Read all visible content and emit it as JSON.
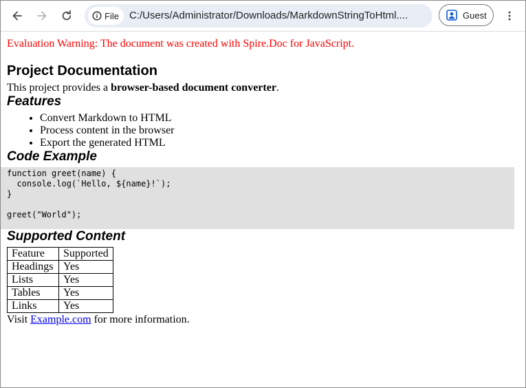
{
  "browser": {
    "nav": {
      "back_icon": "arrow-left-icon",
      "forward_icon": "arrow-right-icon",
      "reload_icon": "reload-icon"
    },
    "address_bar": {
      "chip_label": "File",
      "chip_icon": "info-circle-icon",
      "url": "C:/Users/Administrator/Downloads/MarkdownStringToHtml...."
    },
    "profile": {
      "label": "Guest",
      "icon": "person-badge-icon"
    },
    "menu_icon": "kebab-menu-icon"
  },
  "page": {
    "warning": "Evaluation Warning: The document was created with Spire.Doc for JavaScript.",
    "title": "Project Documentation",
    "intro": {
      "prefix": "This project provides a ",
      "bold": "browser-based document converter",
      "suffix": "."
    },
    "features": {
      "heading": "Features",
      "items": [
        "Convert Markdown to HTML",
        "Process content in the browser",
        "Export the generated HTML"
      ]
    },
    "code": {
      "heading": "Code Example",
      "text": "function greet(name) {\n  console.log(`Hello, ${name}!`);\n}\n\ngreet(\"World\");"
    },
    "supported": {
      "heading": "Supported Content",
      "rows": [
        [
          "Feature",
          "Supported"
        ],
        [
          "Headings",
          "Yes"
        ],
        [
          "Lists",
          "Yes"
        ],
        [
          "Tables",
          "Yes"
        ],
        [
          "Links",
          "Yes"
        ]
      ]
    },
    "footer": {
      "prefix": "Visit ",
      "link_text": "Example.com",
      "suffix": " for more information."
    }
  },
  "colors": {
    "warning": "#ff0000",
    "link": "#0000ee",
    "code_bg": "#e0e0e0",
    "omnibox_bg": "#e9eef6",
    "profile_icon": "#0b57d0"
  }
}
